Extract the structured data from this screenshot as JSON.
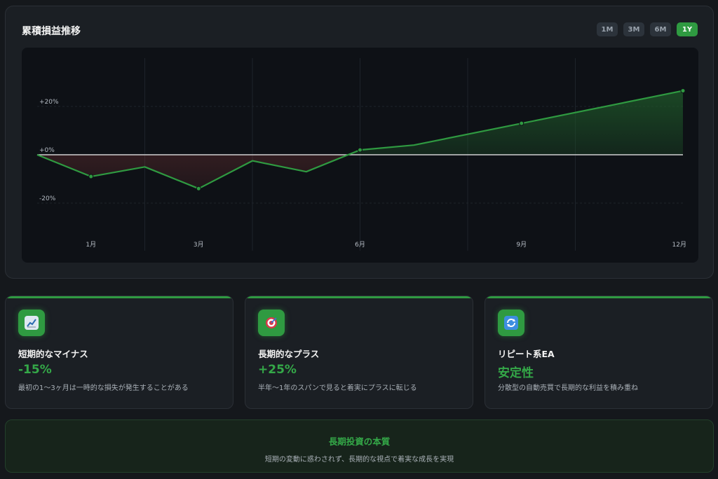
{
  "panel": {
    "title": "累積損益推移",
    "ranges": [
      "1M",
      "3M",
      "6M",
      "1Y"
    ],
    "active_range": "1Y"
  },
  "colors": {
    "accent": "#2f9a41",
    "line": "#2f9a41",
    "loss_fill": "#8a3a3a",
    "gain_fill": "#1f5a2a",
    "zero_line": "#d0d0d0"
  },
  "chart_data": {
    "type": "area",
    "title": "累積損益推移",
    "xlabel": "",
    "ylabel": "",
    "x_tick_labels": [
      {
        "month": 1,
        "label": "1月"
      },
      {
        "month": 3,
        "label": "3月"
      },
      {
        "month": 6,
        "label": "6月"
      },
      {
        "month": 9,
        "label": "9月"
      },
      {
        "month": 12,
        "label": "12月"
      }
    ],
    "y_tick_labels": [
      {
        "value": 20,
        "label": "+20%"
      },
      {
        "value": 0,
        "label": "+0%"
      },
      {
        "value": -20,
        "label": "-20%"
      }
    ],
    "xlim": [
      0,
      12
    ],
    "ylim": [
      -40,
      40
    ],
    "grid": true,
    "series": [
      {
        "x": [
          0,
          1,
          2,
          3,
          4,
          5,
          6,
          7,
          9,
          12
        ],
        "y": [
          0,
          -9,
          -5,
          -14,
          -2.5,
          -7,
          2,
          4,
          13,
          26.5
        ],
        "markers": [
          1,
          3,
          6,
          9,
          12
        ]
      }
    ]
  },
  "cards": [
    {
      "icon": "chart-increasing-icon",
      "title": "短期的なマイナス",
      "value": "-15%",
      "desc": "最初の1〜3ヶ月は一時的な損失が発生することがある"
    },
    {
      "icon": "target-icon",
      "title": "長期的なプラス",
      "value": "+25%",
      "desc": "半年〜1年のスパンで見ると着実にプラスに転じる"
    },
    {
      "icon": "repeat-icon",
      "title": "リピート系EA",
      "value": "安定性",
      "desc": "分散型の自動売買で長期的な利益を積み重ね"
    }
  ],
  "summary": {
    "title": "長期投資の本質",
    "desc": "短期の変動に惑わされず、長期的な視点で着実な成長を実現"
  }
}
